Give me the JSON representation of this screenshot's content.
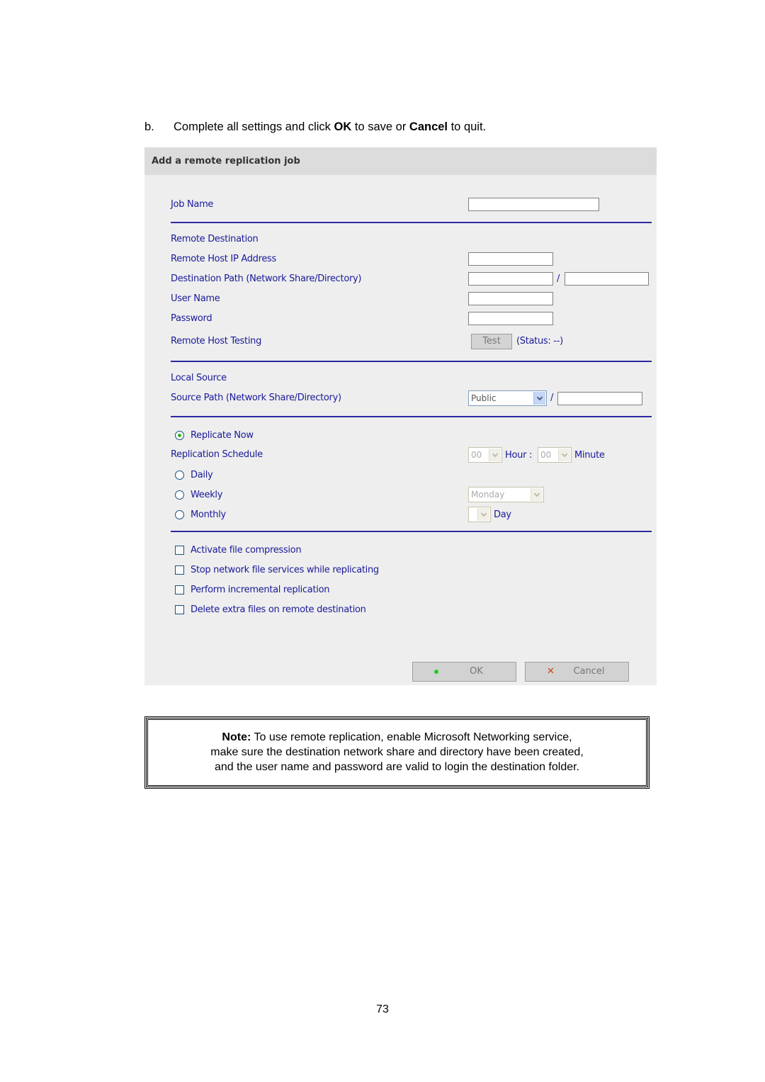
{
  "instruction": {
    "step": "b.",
    "part1": "Complete all settings and click ",
    "ok_word": "OK",
    "part2": " to save or ",
    "cancel_word": "Cancel",
    "part3": " to quit."
  },
  "panel": {
    "title": "Add a remote replication job",
    "job_name": {
      "label": "Job Name",
      "value": ""
    },
    "remote": {
      "section_label": "Remote Destination",
      "host_ip": {
        "label": "Remote Host IP Address",
        "value": ""
      },
      "dest_path": {
        "label": "Destination Path (Network Share/Directory)",
        "share_value": "",
        "dir_value": "",
        "separator": "/"
      },
      "user_name": {
        "label": "User Name",
        "value": ""
      },
      "password": {
        "label": "Password",
        "value": ""
      },
      "testing": {
        "label": "Remote Host Testing",
        "button": "Test",
        "status": "(Status: --)"
      }
    },
    "local": {
      "section_label": "Local Source",
      "source_path": {
        "label": "Source Path (Network Share/Directory)",
        "share_selected": "Public",
        "dir_value": "",
        "separator": "/"
      }
    },
    "schedule": {
      "replicate_now": {
        "label": "Replicate Now",
        "checked": true
      },
      "label": "Replication Schedule",
      "hour": {
        "value": "00",
        "label": "Hour :"
      },
      "minute": {
        "value": "00",
        "label": "Minute"
      },
      "daily": {
        "label": "Daily",
        "checked": false
      },
      "weekly": {
        "label": "Weekly",
        "checked": false,
        "day_selected": "Monday"
      },
      "monthly": {
        "label": "Monthly",
        "checked": false,
        "day_value": "",
        "day_label": "Day"
      }
    },
    "options": [
      {
        "label": "Activate file compression",
        "checked": false
      },
      {
        "label": "Stop network file services while replicating",
        "checked": false
      },
      {
        "label": "Perform incremental replication",
        "checked": false
      },
      {
        "label": "Delete extra files on remote destination",
        "checked": false
      }
    ],
    "buttons": {
      "ok": "OK",
      "cancel": "Cancel"
    }
  },
  "note": {
    "bold": "Note:",
    "line1": " To use remote replication, enable Microsoft Networking service,",
    "line2": "make sure the destination network share and directory have been created,",
    "line3": "and the user name and password are valid to login the destination folder."
  },
  "page_number": "73"
}
